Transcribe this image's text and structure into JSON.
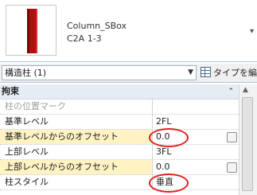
{
  "type_header": {
    "family_name": "Column_SBox",
    "type_name": "C2A 1-3",
    "thumbnail_icon": "red-column-icon",
    "colors": {
      "column": "#b01010"
    }
  },
  "selector": {
    "instance_value": "構造柱 (1)",
    "edit_type_label": "タイプを編集"
  },
  "groups": [
    {
      "title": "拘束",
      "rows": [
        {
          "name": "柱の位置マーク",
          "value": "",
          "disabled": true
        },
        {
          "name": "基準レベル",
          "value": "2FL"
        },
        {
          "name": "基準レベルからのオフセット",
          "value": "0.0",
          "circled": true
        },
        {
          "name": "上部レベル",
          "value": "3FL"
        },
        {
          "name": "上部レベルからのオフセット",
          "value": "0.0",
          "circled": true
        },
        {
          "name": "柱スタイル",
          "value": "垂直"
        }
      ]
    }
  ],
  "annotation_color": "#e02020"
}
